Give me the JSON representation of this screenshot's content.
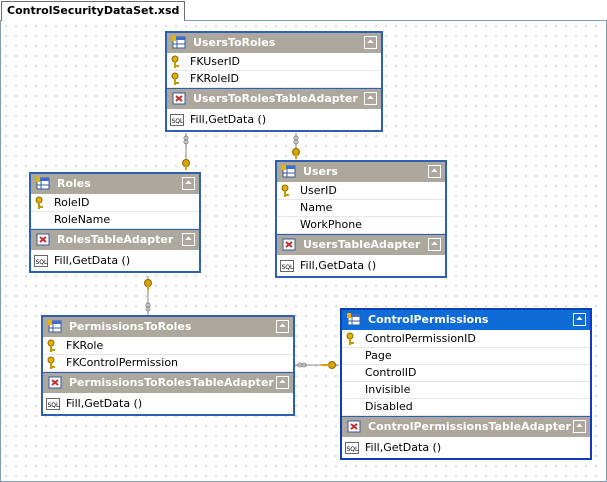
{
  "tab": {
    "title": "ControlSecurityDataSet.xsd"
  },
  "colors": {
    "table_border": "#2e5fb0",
    "header_gray": "#ada89d",
    "header_selected": "#0f6bd8",
    "key_gold": "#d8a400"
  },
  "tables": {
    "users_to_roles": {
      "name": "UsersToRoles",
      "columns": [
        "FKUserID",
        "FKRoleID"
      ],
      "adapter": "UsersToRolesTableAdapter",
      "methods": "Fill,GetData ()"
    },
    "roles": {
      "name": "Roles",
      "columns": [
        "RoleID",
        "RoleName"
      ],
      "adapter": "RolesTableAdapter",
      "methods": "Fill,GetData ()"
    },
    "users": {
      "name": "Users",
      "columns": [
        "UserID",
        "Name",
        "WorkPhone"
      ],
      "adapter": "UsersTableAdapter",
      "methods": "Fill,GetData ()"
    },
    "permissions_to_roles": {
      "name": "PermissionsToRoles",
      "columns": [
        "FKRole",
        "FKControlPermission"
      ],
      "adapter": "PermissionsToRolesTableAdapter",
      "methods": "Fill,GetData ()"
    },
    "control_permissions": {
      "name": "ControlPermissions",
      "columns": [
        "ControlPermissionID",
        "Page",
        "ControlID",
        "Invisible",
        "Disabled"
      ],
      "adapter": "ControlPermissionsTableAdapter",
      "methods": "Fill,GetData ()"
    }
  },
  "icons": {
    "table": "datatable-icon",
    "adapter": "tableadapter-icon",
    "key": "primary-key-icon",
    "sql": "sql-query-icon",
    "collapse": "collapse-chevron-icon"
  }
}
